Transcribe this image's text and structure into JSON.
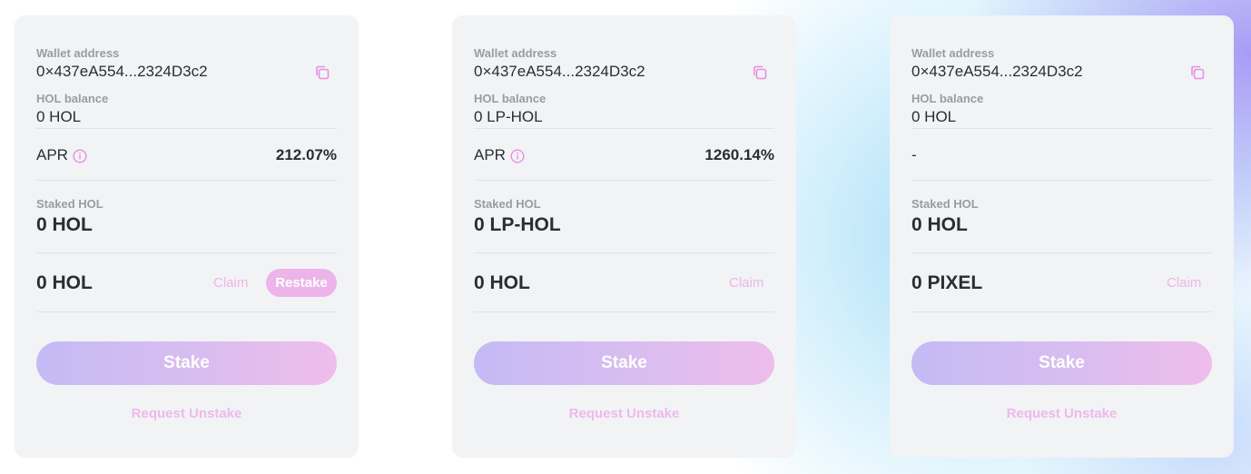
{
  "theme": {
    "accent": "#e58ee4",
    "claim_color": "#ecb6ea",
    "stake_gradient": [
      "#c4baf4",
      "#eebdeb"
    ]
  },
  "cards": [
    {
      "wallet_label": "Wallet address",
      "wallet_address": "0×437eA554...2324D3c2",
      "balance_label": "HOL balance",
      "balance_value": "0 HOL",
      "apr_label": "APR",
      "apr_value": "212.07%",
      "staked_label": "Staked HOL",
      "staked_value": "0 HOL",
      "reward_value": "0 HOL",
      "claim_label": "Claim",
      "restake_label": "Restake",
      "stake_label": "Stake",
      "unstake_label": "Request Unstake"
    },
    {
      "wallet_label": "Wallet address",
      "wallet_address": "0×437eA554...2324D3c2",
      "balance_label": "HOL balance",
      "balance_value": "0 LP-HOL",
      "apr_label": "APR",
      "apr_value": "1260.14%",
      "staked_label": "Staked HOL",
      "staked_value": "0 LP-HOL",
      "reward_value": "0 HOL",
      "claim_label": "Claim",
      "stake_label": "Stake",
      "unstake_label": "Request Unstake"
    },
    {
      "wallet_label": "Wallet address",
      "wallet_address": "0×437eA554...2324D3c2",
      "balance_label": "HOL balance",
      "balance_value": "0 HOL",
      "apr_value": "-",
      "staked_label": "Staked HOL",
      "staked_value": "0 HOL",
      "reward_value": "0 PIXEL",
      "claim_label": "Claim",
      "stake_label": "Stake",
      "unstake_label": "Request Unstake"
    }
  ]
}
